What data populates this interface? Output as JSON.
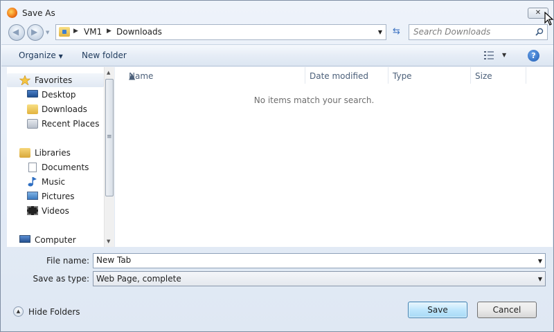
{
  "window": {
    "title": "Save As",
    "close_label": "✕"
  },
  "address": {
    "crumbs": [
      "VM1",
      "Downloads"
    ],
    "search_placeholder": "Search Downloads"
  },
  "toolbar": {
    "organize_label": "Organize",
    "new_folder_label": "New folder",
    "help_label": "?"
  },
  "nav": {
    "favorites": "Favorites",
    "desktop": "Desktop",
    "downloads": "Downloads",
    "recent_places": "Recent Places",
    "libraries": "Libraries",
    "documents": "Documents",
    "music": "Music",
    "pictures": "Pictures",
    "videos": "Videos",
    "computer": "Computer"
  },
  "files": {
    "columns": [
      "Name",
      "Date modified",
      "Type",
      "Size"
    ],
    "empty_message": "No items match your search."
  },
  "form": {
    "file_name_label": "File name:",
    "file_name_value": "New Tab",
    "save_as_type_label": "Save as type:",
    "save_as_type_value": "Web Page, complete"
  },
  "footer": {
    "hide_folders_label": "Hide Folders",
    "save_label": "Save",
    "cancel_label": "Cancel"
  }
}
